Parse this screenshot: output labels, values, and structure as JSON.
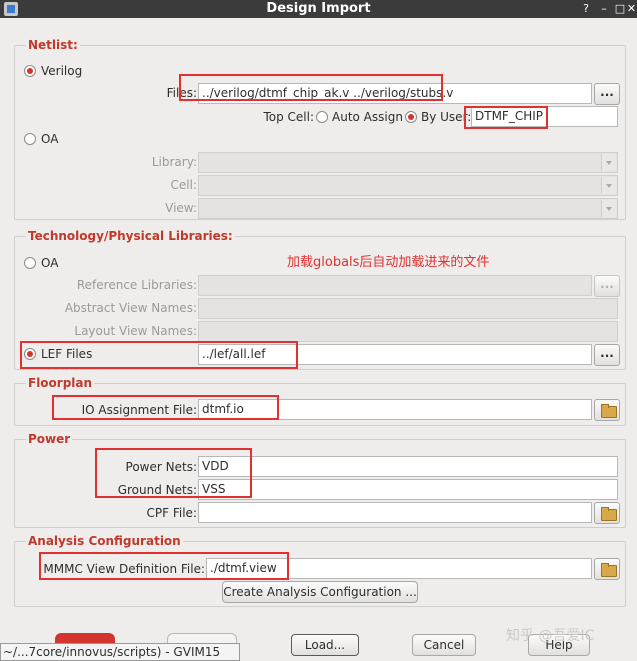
{
  "window": {
    "title": "Design Import",
    "controls": [
      "?",
      "–",
      "□",
      "✕"
    ]
  },
  "netlist": {
    "title": "Netlist:",
    "verilog_label": "Verilog",
    "files_label": "Files:",
    "files_value": "../verilog/dtmf_chip_ak.v ../verilog/stubs.v",
    "top_cell_label": "Top Cell:",
    "auto_assign_label": "Auto Assign",
    "by_user_label": "By User:",
    "top_cell_value": "DTMF_CHIP",
    "oa_label": "OA",
    "library_label": "Library:",
    "cell_label": "Cell:",
    "view_label": "View:"
  },
  "tech": {
    "title": "Technology/Physical Libraries:",
    "oa_label": "OA",
    "annotation": "加载globals后自动加载进来的文件",
    "ref_libs_label": "Reference Libraries:",
    "abstract_label": "Abstract View Names:",
    "layout_label": "Layout View Names:",
    "lef_label": "LEF Files",
    "lef_value": "../lef/all.lef"
  },
  "floorplan": {
    "title": "Floorplan",
    "io_label": "IO Assignment File:",
    "io_value": "dtmf.io"
  },
  "power": {
    "title": "Power",
    "power_nets_label": "Power Nets:",
    "power_nets_value": "VDD",
    "ground_nets_label": "Ground Nets:",
    "ground_nets_value": "VSS",
    "cpf_label": "CPF File:",
    "cpf_value": ""
  },
  "analysis": {
    "title": "Analysis Configuration",
    "mmmc_label": "MMMC View Definition File:",
    "mmmc_value": "./dtmf.view",
    "create_button": "Create Analysis Configuration ..."
  },
  "bottom": {
    "load_button": "Load...",
    "cancel_button": "Cancel",
    "help_button": "Help",
    "taskbar_text": "~/...7core/innovus/scripts) - GVIM15",
    "watermark": "知乎 @吾爱IC",
    "browse_label": "..."
  },
  "colors": {
    "section_title": "#c0392b",
    "annotation": "#e03030",
    "titlebar": "#3b3b3b"
  }
}
